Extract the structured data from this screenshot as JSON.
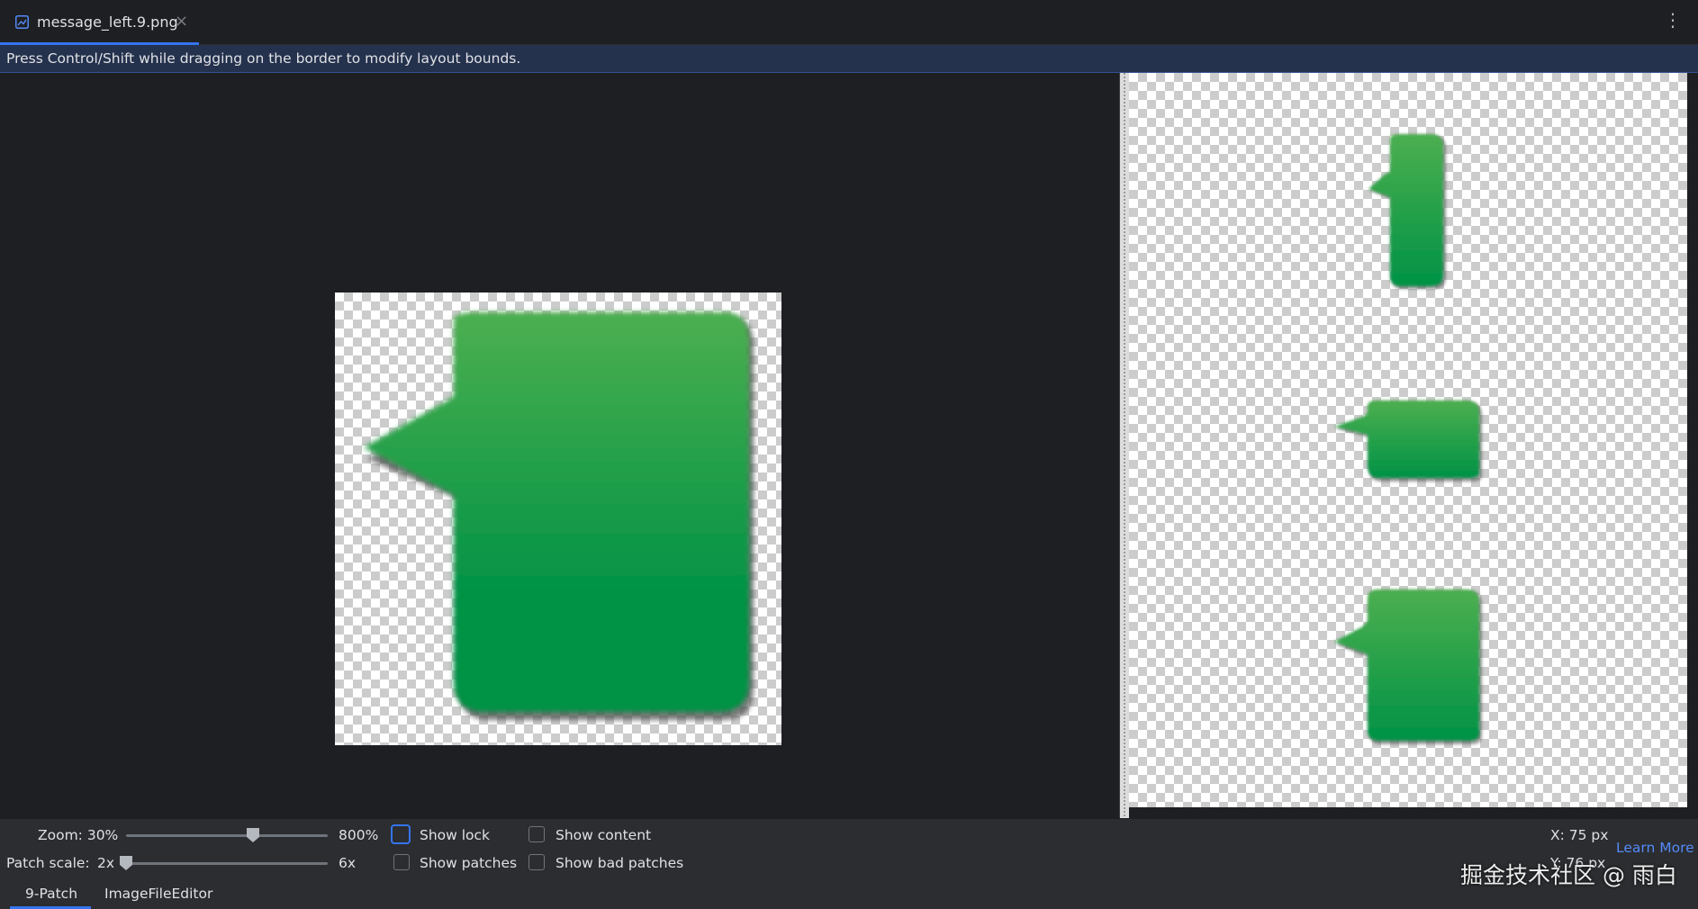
{
  "tab": {
    "label": "message_left.9.png",
    "icon": "image-file-icon",
    "close_icon": "close-icon"
  },
  "menu_icon": "more-vertical-icon",
  "banner": {
    "text": "Press Control/Shift while dragging on the border to modify layout bounds."
  },
  "toolbar": {
    "zoom_label": "Zoom: 30%",
    "zoom_max": "800%",
    "zoom_level": 0.63,
    "patch_scale_label": "Patch scale:",
    "patch_scale_min": "2x",
    "patch_scale_max": "6x",
    "patch_scale_level": 0.0,
    "show_lock": "Show lock",
    "show_lock_checked": false,
    "show_content": "Show content",
    "show_content_checked": false,
    "show_patches": "Show patches",
    "show_patches_checked": false,
    "show_bad_patches": "Show bad patches",
    "show_bad_patches_checked": false,
    "coord_x": "X: 75 px",
    "coord_y": "Y: 76 px",
    "learn_more": "Learn More"
  },
  "bottom_tabs": [
    {
      "label": "9-Patch",
      "active": true
    },
    {
      "label": "ImageFileEditor",
      "active": false
    }
  ],
  "watermark": "掘金技术社区 @ 雨白",
  "colors": {
    "accent": "#3574f0",
    "bubble_top": "#4caf50",
    "bubble_bottom": "#009245",
    "link": "#548af7"
  }
}
